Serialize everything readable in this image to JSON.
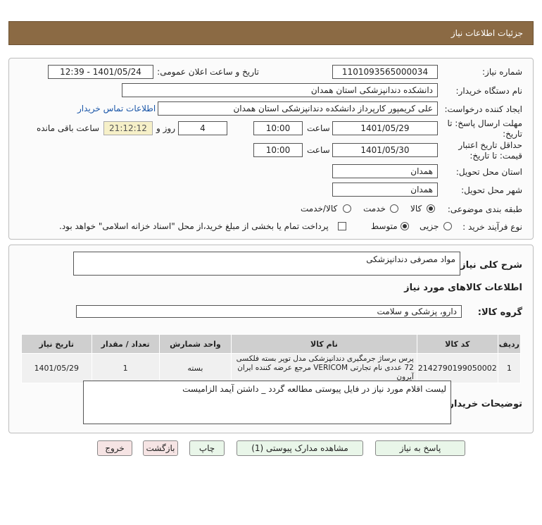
{
  "header": {
    "title": "جزئیات اطلاعات نیاز"
  },
  "form": {
    "need_number_label": "شماره نیاز:",
    "need_number": "1101093565000034",
    "announce_label": "تاریخ و ساعت اعلان عمومی:",
    "announce_value": "1401/05/24 - 12:39",
    "buyer_org_label": "نام دستگاه خریدار:",
    "buyer_org": "دانشکده دندانپزشکی استان همدان",
    "creator_label": "ایجاد کننده درخواست:",
    "creator": "علی کریمپور کارپرداز دانشکده دندانپزشکی استان همدان",
    "contact_link": "اطلاعات تماس خریدار",
    "deadline_label_1": "مهلت ارسال پاسخ: تا",
    "deadline_label_2": "تاریخ:",
    "deadline_date": "1401/05/29",
    "time_label": "ساعت",
    "deadline_time": "10:00",
    "days_value": "4",
    "days_label": "روز و",
    "remaining_time": "21:12:12",
    "remaining_label": "ساعت باقی مانده",
    "validity_label_1": "حداقل تاریخ اعتبار",
    "validity_label_2": "قیمت: تا تاریخ:",
    "validity_date": "1401/05/30",
    "validity_time": "10:00",
    "province_label": "استان محل تحویل:",
    "province": "همدان",
    "city_label": "شهر محل تحویل:",
    "city": "همدان",
    "category_label": "طبقه بندی موضوعی:",
    "category_options": [
      "کالا",
      "خدمت",
      "کالا/خدمت"
    ],
    "category_selected": "کالا",
    "process_label": "نوع فرآیند خرید :",
    "process_options": [
      "جزیی",
      "متوسط"
    ],
    "process_selected": "متوسط",
    "payment_note": "پرداخت تمام یا بخشی از مبلغ خرید،از محل \"اسناد خزانه اسلامی\" خواهد بود."
  },
  "summary": {
    "desc_label": "شرح کلی نیاز:",
    "desc_value": "مواد مصرفی دندانپزشکی",
    "goods_info_title": "اطلاعات کالاهای مورد نیاز",
    "group_label": "گروه کالا:",
    "group_value": "دارو، پزشکی و سلامت",
    "table": {
      "headers": [
        "ردیف",
        "کد کالا",
        "نام کالا",
        "واحد شمارش",
        "تعداد / مقدار",
        "تاریخ نیاز"
      ],
      "rows": [
        [
          "1",
          "2142790199050002",
          "پرس برساژ جرمگیری دندانپزشکی مدل توپر بسته فلکسی 72 عددی نام تجارتی VERICOM مرجع عرضه کننده ایران آیرون",
          "بسته",
          "1",
          "1401/05/29"
        ]
      ]
    },
    "buyer_notes_label": "توضیحات خریدار:",
    "buyer_notes": "لیست اقلام مورد نیاز در فایل پیوستی مطالعه گردد  _  داشتن آیمد الزامیست"
  },
  "buttons": {
    "reply": "پاسخ به نیاز",
    "view_docs": "مشاهده مدارک پیوستی (1)",
    "print": "چاپ",
    "back": "بازگشت",
    "exit": "خروج"
  }
}
